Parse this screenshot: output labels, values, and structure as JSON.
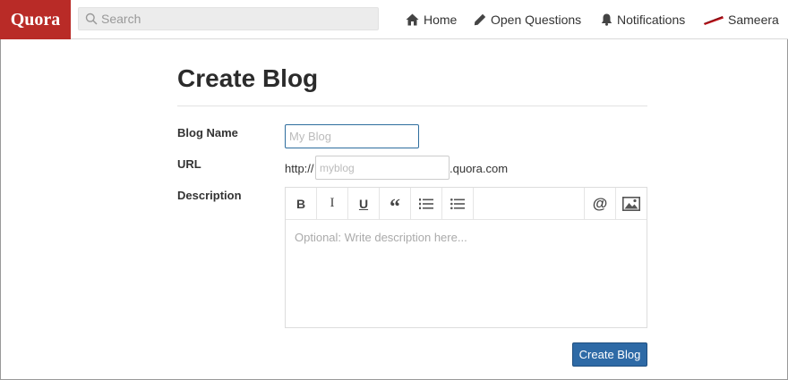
{
  "header": {
    "logo": "Quora",
    "search": {
      "placeholder": "Search"
    },
    "nav": [
      {
        "label": "Home",
        "icon": "home-icon"
      },
      {
        "label": "Open Questions",
        "icon": "pencil-icon"
      },
      {
        "label": "Notifications",
        "icon": "bell-icon"
      },
      {
        "label": "Sameera",
        "icon": "avatar"
      }
    ]
  },
  "form": {
    "title": "Create Blog",
    "blog_name": {
      "label": "Blog Name",
      "placeholder": "My Blog",
      "value": ""
    },
    "url": {
      "label": "URL",
      "prefix": "http://",
      "placeholder": "myblog",
      "value": "",
      "suffix": ".quora.com"
    },
    "description": {
      "label": "Description",
      "placeholder": "Optional: Write description here...",
      "value": "",
      "toolbar": [
        {
          "name": "bold",
          "text": "B"
        },
        {
          "name": "italic",
          "text": "I"
        },
        {
          "name": "underline",
          "text": "U"
        },
        {
          "name": "quote",
          "text": "“"
        },
        {
          "name": "numbered-list",
          "icon": "numbered-list-icon"
        },
        {
          "name": "bullet-list",
          "icon": "bullet-list-icon"
        },
        {
          "name": "mention",
          "text": "@"
        },
        {
          "name": "image",
          "icon": "image-icon"
        }
      ]
    },
    "submit_label": "Create Blog"
  },
  "colors": {
    "brand": "#b92b27",
    "primary_button": "#2e6aa6",
    "focus_border": "#2e6d9e"
  }
}
